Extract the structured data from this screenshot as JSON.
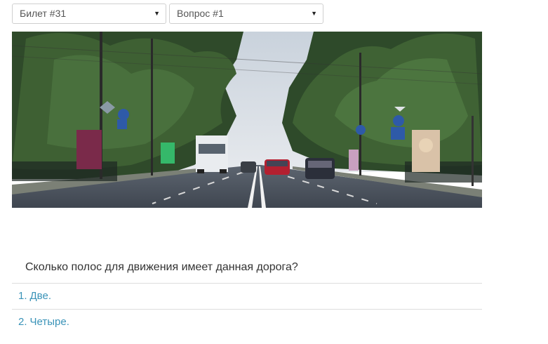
{
  "selectors": {
    "ticket": "Билет #31",
    "question": "Вопрос #1"
  },
  "question_text": "Сколько полос для движения имеет данная дорога?",
  "answers": [
    {
      "number": "1.",
      "text": "Две."
    },
    {
      "number": "2.",
      "text": "Четыре."
    }
  ],
  "colors": {
    "answer_link": "#3a93b8",
    "divider": "#dddddd",
    "text": "#333333"
  }
}
